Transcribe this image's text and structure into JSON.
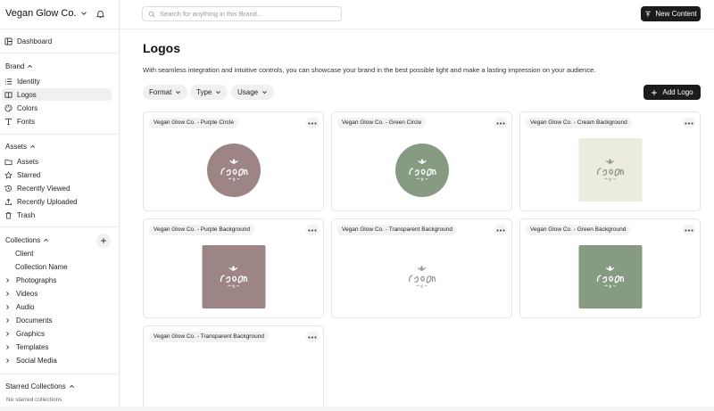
{
  "app": {
    "workspace_name": "Vegan Glow Co.",
    "search_placeholder": "Search for anything in this Brand...",
    "new_content_label": "New Content"
  },
  "sidebar": {
    "dashboard": "Dashboard",
    "brand": {
      "heading": "Brand",
      "items": [
        {
          "label": "Identity",
          "icon": "list-icon"
        },
        {
          "label": "Logos",
          "icon": "book-icon",
          "active": true
        },
        {
          "label": "Colors",
          "icon": "palette-icon"
        },
        {
          "label": "Fonts",
          "icon": "type-icon"
        }
      ]
    },
    "assets": {
      "heading": "Assets",
      "items": [
        {
          "label": "Assets",
          "icon": "folder-icon"
        },
        {
          "label": "Starred",
          "icon": "star-icon"
        },
        {
          "label": "Recently Viewed",
          "icon": "history-icon"
        },
        {
          "label": "Recently Uploaded",
          "icon": "upload-icon"
        },
        {
          "label": "Trash",
          "icon": "trash-icon"
        }
      ]
    },
    "collections": {
      "heading": "Collections",
      "sub_items": [
        "Client",
        "Collection Name"
      ],
      "tree_items": [
        "Photographs",
        "Videos",
        "Audio",
        "Documents",
        "Graphics",
        "Templates",
        "Social Media"
      ]
    },
    "starred_collections": {
      "heading": "Starred Collections",
      "empty_text": "No starred collections"
    }
  },
  "main": {
    "title": "Logos",
    "description": "With seamless integration and intuitive controls, you can showcase your brand in the best possible light and make a lasting impression on your audience.",
    "filters": [
      "Format",
      "Type",
      "Usage"
    ],
    "add_logo_label": "Add Logo",
    "logos": [
      {
        "label": "Vegan Glow Co. - Purple Circle",
        "shape": "circle",
        "bg": "#9e8585",
        "fg": "#ffffff"
      },
      {
        "label": "Vegan Glow Co. - Green Circle",
        "shape": "circle",
        "bg": "#879a82",
        "fg": "#ffffff"
      },
      {
        "label": "Vegan Glow Co. - Cream Background",
        "shape": "square",
        "bg": "#ecebdf",
        "fg": "#8a9a84"
      },
      {
        "label": "Vegan Glow Co. - Purple Background",
        "shape": "square",
        "bg": "#9e8585",
        "fg": "#ffffff"
      },
      {
        "label": "Vegan Glow Co. - Transparent Background",
        "shape": "square",
        "bg": "transparent",
        "fg": "#9a9a9a"
      },
      {
        "label": "Vegan Glow Co. - Green Background",
        "shape": "square",
        "bg": "#879a82",
        "fg": "#ffffff"
      },
      {
        "label": "Vegan Glow Co. - Transparent Background",
        "shape": "none",
        "bg": "transparent",
        "fg": "#9a9a9a"
      }
    ]
  },
  "colors": {
    "primary_button": "#1c1c1c",
    "active_nav": "#f0f0f0"
  }
}
